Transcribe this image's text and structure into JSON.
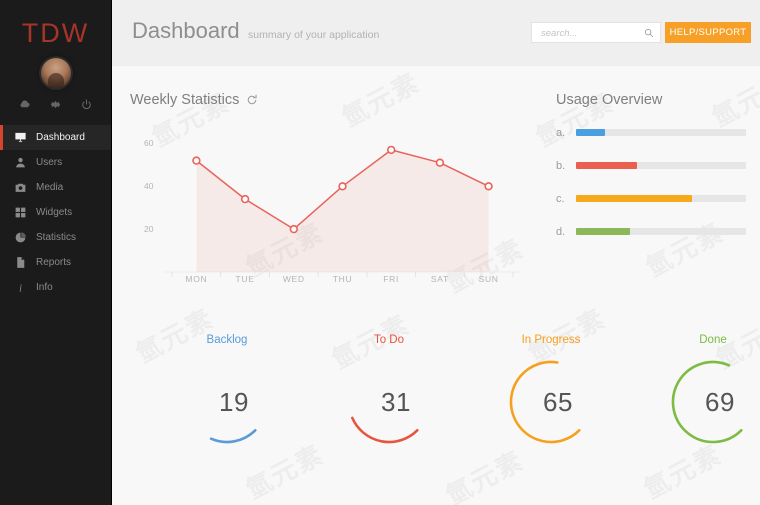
{
  "brand": "TDW",
  "sidebar": {
    "quick_icons": [
      {
        "name": "cloud-icon",
        "label": "cloud"
      },
      {
        "name": "gear-icon",
        "label": "settings"
      },
      {
        "name": "power-icon",
        "label": "power"
      }
    ],
    "items": [
      {
        "label": "Dashboard",
        "icon": "monitor-icon",
        "active": true
      },
      {
        "label": "Users",
        "icon": "user-icon",
        "active": false
      },
      {
        "label": "Media",
        "icon": "camera-icon",
        "active": false
      },
      {
        "label": "Widgets",
        "icon": "grid-icon",
        "active": false
      },
      {
        "label": "Statistics",
        "icon": "pie-chart-icon",
        "active": false
      },
      {
        "label": "Reports",
        "icon": "document-icon",
        "active": false
      },
      {
        "label": "Info",
        "icon": "info-icon",
        "active": false
      }
    ]
  },
  "header": {
    "title": "Dashboard",
    "subtitle": "summary of your application",
    "search_placeholder": "search...",
    "search_value": "",
    "help_label": "HELP/SUPPORT",
    "help_color": "#f6a028"
  },
  "chart_panel": {
    "title": "Weekly Statistics",
    "refresh_icon": "refresh-icon"
  },
  "chart_data": {
    "type": "line",
    "title": "Weekly Statistics",
    "categories": [
      "MON",
      "TUE",
      "WED",
      "THU",
      "FRI",
      "SAT",
      "SUN"
    ],
    "values": [
      52,
      34,
      20,
      40,
      57,
      51,
      40
    ],
    "xlabel": "",
    "ylabel": "",
    "ylim": [
      0,
      70
    ],
    "yticks": [
      20,
      40,
      60
    ],
    "grid": false,
    "line_color": "#e8635a",
    "fill_color": "rgba(232,99,90,0.09)",
    "marker": "open-circle",
    "legend": "none"
  },
  "usage": {
    "title": "Usage Overview",
    "bars": [
      {
        "key": "a.",
        "percent": 17,
        "color": "#4a9fe0"
      },
      {
        "key": "b.",
        "percent": 36,
        "color": "#ea5f4f"
      },
      {
        "key": "c.",
        "percent": 68,
        "color": "#f6a91b"
      },
      {
        "key": "d.",
        "percent": 32,
        "color": "#8cb85a"
      }
    ],
    "track_color": "#e6e6e6"
  },
  "gauges": [
    {
      "label": "Backlog",
      "value": "19",
      "percent": 19,
      "color": "#5a9bd8"
    },
    {
      "label": "To Do",
      "value": "31",
      "percent": 31,
      "color": "#e8553f"
    },
    {
      "label": "In Progress",
      "value": "65",
      "percent": 65,
      "color": "#f6a01e"
    },
    {
      "label": "Done",
      "value": "69",
      "percent": 69,
      "color": "#7dbb42"
    }
  ],
  "watermark": "氫元素"
}
